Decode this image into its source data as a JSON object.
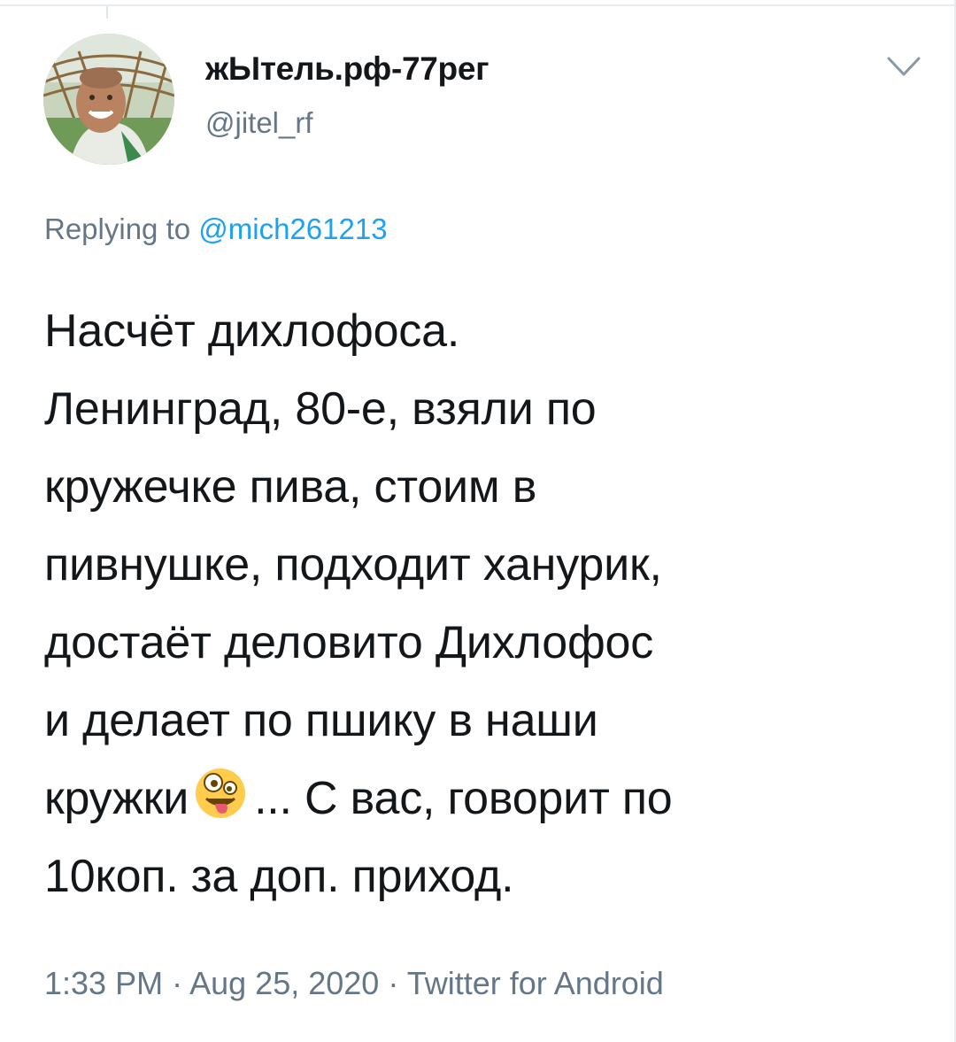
{
  "tweet": {
    "display_name": "жЫтель.рф-77рег",
    "handle": "@jitel_rf",
    "reply_prefix": "Replying to",
    "reply_to": "@mich261213",
    "text_lines": [
      "Насчёт дихлофоса.",
      "Ленинград, 80-е, взяли по",
      "кружечке пива, стоим в",
      "пивнушке, подходит ханурик,",
      "достаёт деловито Дихлофос",
      "и делает по пшику в наши"
    ],
    "line7_before_emoji": "кружки",
    "line7_after_emoji": "... С вас, говорит по",
    "line8": "10коп. за доп. приход.",
    "emoji": "zany-face-emoji",
    "time": "1:33 PM",
    "separator": "·",
    "date": "Aug 25, 2020",
    "source": "Twitter for Android"
  },
  "colors": {
    "text": "#14171a",
    "secondary": "#657786",
    "link": "#1da1f2"
  },
  "icons": {
    "more": "chevron-down-icon"
  }
}
